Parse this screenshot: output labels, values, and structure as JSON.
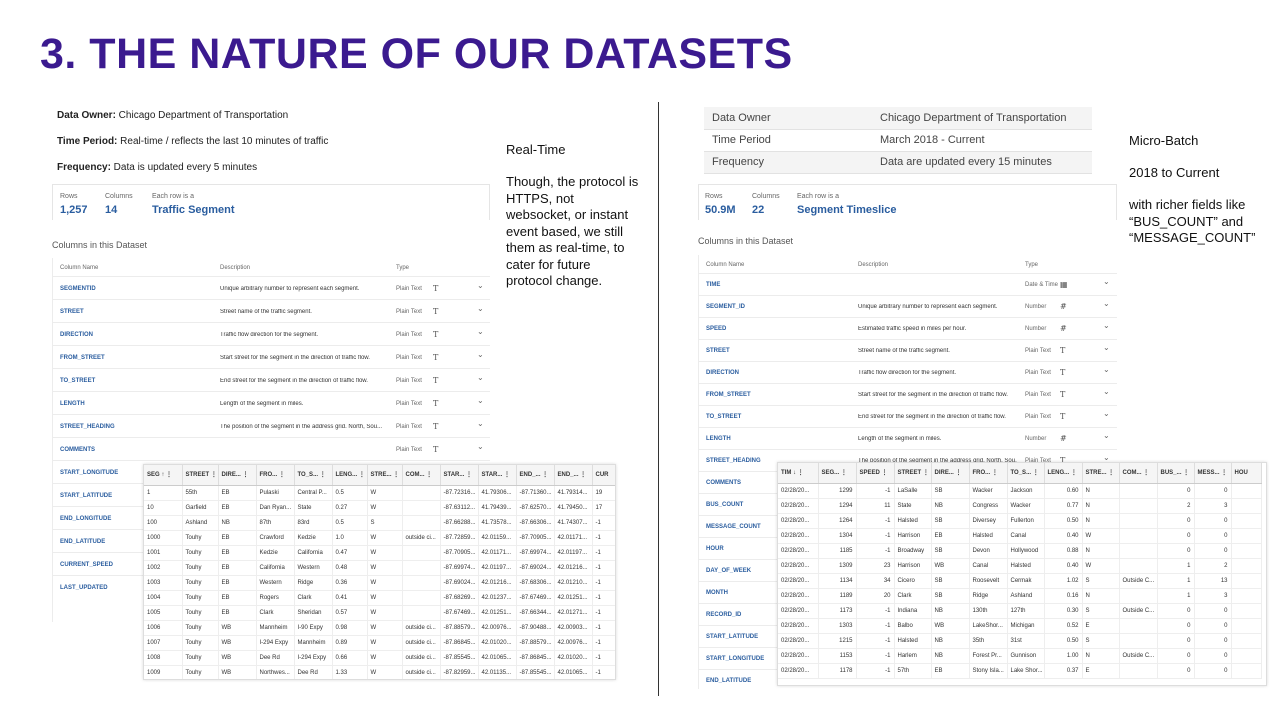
{
  "slide": {
    "title": "3. THE NATURE OF OUR DATASETS"
  },
  "left": {
    "meta": [
      {
        "label": "Data Owner:",
        "value": " Chicago Department of Transportation"
      },
      {
        "label": "Time Period:",
        "value": " Real-time / reflects the last 10 minutes of traffic"
      },
      {
        "label": "Frequency:",
        "value": " Data is updated every 5 minutes"
      }
    ],
    "note": {
      "heading": "Real-Time",
      "lines": [
        "Though, the protocol is",
        "HTTPS, not",
        "websocket, or instant",
        "event based, we still",
        "them as real-time, to",
        "cater for future",
        "protocol change."
      ]
    },
    "summary": {
      "rows_label": "Rows",
      "rows": "1,257",
      "cols_label": "Columns",
      "cols": "14",
      "each_label": "Each row is a",
      "each": "Traffic Segment"
    },
    "columns_title": "Columns in this Dataset",
    "col_header": {
      "name": "Column Name",
      "desc": "Description",
      "type": "Type"
    },
    "columns": [
      {
        "name": "SEGMENTID",
        "desc": "Unique arbitrary number to represent each segment.",
        "type": "Plain Text",
        "icon": "T"
      },
      {
        "name": "STREET",
        "desc": "Street name of the traffic segment.",
        "type": "Plain Text",
        "icon": "T"
      },
      {
        "name": "DIRECTION",
        "desc": "Traffic flow direction for the segment.",
        "type": "Plain Text",
        "icon": "T"
      },
      {
        "name": "FROM_STREET",
        "desc": "Start street for the segment in the direction of traffic flow.",
        "type": "Plain Text",
        "icon": "T"
      },
      {
        "name": "TO_STREET",
        "desc": "End street for the segment in the direction of traffic flow.",
        "type": "Plain Text",
        "icon": "T"
      },
      {
        "name": "LENGTH",
        "desc": "Length of the segment in miles.",
        "type": "Plain Text",
        "icon": "T"
      },
      {
        "name": "STREET_HEADING",
        "desc": "The position of the segment in the address grid. North, Sou...",
        "type": "Plain Text",
        "icon": "T"
      },
      {
        "name": "COMMENTS",
        "desc": "",
        "type": "Plain Text",
        "icon": "T"
      },
      {
        "name": "START_LONGITUDE",
        "desc": "",
        "type": "",
        "icon": ""
      },
      {
        "name": "START_LATITUDE",
        "desc": "",
        "type": "",
        "icon": ""
      },
      {
        "name": "END_LONGITUDE",
        "desc": "",
        "type": "",
        "icon": ""
      },
      {
        "name": "END_LATITUDE",
        "desc": "",
        "type": "",
        "icon": ""
      },
      {
        "name": "CURRENT_SPEED",
        "desc": "",
        "type": "",
        "icon": ""
      },
      {
        "name": "LAST_UPDATED",
        "desc": "",
        "type": "",
        "icon": ""
      }
    ],
    "grid": {
      "headers": [
        "SEG ↑ ⋮",
        "STREET ⋮",
        "DIRE... ⋮",
        "FRO... ⋮",
        "TO_S... ⋮",
        "LENG... ⋮",
        "STRE... ⋮",
        "COM... ⋮",
        "STAR... ⋮",
        "STAR... ⋮",
        "END_... ⋮",
        "END_... ⋮",
        "CUR"
      ],
      "rows": [
        [
          "1",
          "55th",
          "EB",
          "Pulaski",
          "Central P...",
          "0.5",
          "W",
          "",
          "-87.72316...",
          "41.79306...",
          "-87.71360...",
          "41.79314...",
          "19"
        ],
        [
          "10",
          "Garfield",
          "EB",
          "Dan Ryan...",
          "State",
          "0.27",
          "W",
          "",
          "-87.63112...",
          "41.79439...",
          "-87.62570...",
          "41.79450...",
          "17"
        ],
        [
          "100",
          "Ashland",
          "NB",
          "87th",
          "83rd",
          "0.5",
          "S",
          "",
          "-87.66288...",
          "41.73578...",
          "-87.66306...",
          "41.74307...",
          "-1"
        ],
        [
          "1000",
          "Touhy",
          "EB",
          "Crawford",
          "Kedzie",
          "1.0",
          "W",
          "outside ci...",
          "-87.72859...",
          "42.01159...",
          "-87.70905...",
          "42.01171...",
          "-1"
        ],
        [
          "1001",
          "Touhy",
          "EB",
          "Kedzie",
          "California",
          "0.47",
          "W",
          "",
          "-87.70905...",
          "42.01171...",
          "-87.69974...",
          "42.01197...",
          "-1"
        ],
        [
          "1002",
          "Touhy",
          "EB",
          "California",
          "Western",
          "0.48",
          "W",
          "",
          "-87.69974...",
          "42.01197...",
          "-87.69024...",
          "42.01216...",
          "-1"
        ],
        [
          "1003",
          "Touhy",
          "EB",
          "Western",
          "Ridge",
          "0.36",
          "W",
          "",
          "-87.69024...",
          "42.01216...",
          "-87.68306...",
          "42.01210...",
          "-1"
        ],
        [
          "1004",
          "Touhy",
          "EB",
          "Rogers",
          "Clark",
          "0.41",
          "W",
          "",
          "-87.68269...",
          "42.01237...",
          "-87.67469...",
          "42.01251...",
          "-1"
        ],
        [
          "1005",
          "Touhy",
          "EB",
          "Clark",
          "Sheridan",
          "0.57",
          "W",
          "",
          "-87.67469...",
          "42.01251...",
          "-87.66344...",
          "42.01271...",
          "-1"
        ],
        [
          "1006",
          "Touhy",
          "WB",
          "Mannheim",
          "I-90 Expy",
          "0.98",
          "W",
          "outside ci...",
          "-87.88579...",
          "42.00976...",
          "-87.90488...",
          "42.00903...",
          "-1"
        ],
        [
          "1007",
          "Touhy",
          "WB",
          "I-294 Expy",
          "Mannheim",
          "0.89",
          "W",
          "outside ci...",
          "-87.86845...",
          "42.01020...",
          "-87.88579...",
          "42.00976...",
          "-1"
        ],
        [
          "1008",
          "Touhy",
          "WB",
          "Dee Rd",
          "I-294 Expy",
          "0.66",
          "W",
          "outside ci...",
          "-87.85545...",
          "42.01065...",
          "-87.86845...",
          "42.01020...",
          "-1"
        ],
        [
          "1009",
          "Touhy",
          "WB",
          "Northwes...",
          "Dee Rd",
          "1.33",
          "W",
          "outside ci...",
          "-87.82959...",
          "42.01135...",
          "-87.85545...",
          "42.01065...",
          "-1"
        ]
      ]
    }
  },
  "right": {
    "meta": [
      {
        "label": "Data Owner",
        "value": "Chicago Department of Transportation"
      },
      {
        "label": "Time Period",
        "value": "March 2018 - Current"
      },
      {
        "label": "Frequency",
        "value": "Data are updated every 15 minutes"
      }
    ],
    "note": {
      "heading": "Micro-Batch",
      "sub": "2018 to Current",
      "lines": [
        "with richer fields like",
        "“BUS_COUNT”  and",
        "“MESSAGE_COUNT”"
      ]
    },
    "summary": {
      "rows_label": "Rows",
      "rows": "50.9M",
      "cols_label": "Columns",
      "cols": "22",
      "each_label": "Each row is a",
      "each": "Segment Timeslice"
    },
    "columns_title": "Columns in this Dataset",
    "col_header": {
      "name": "Column Name",
      "desc": "Description",
      "type": "Type"
    },
    "columns": [
      {
        "name": "TIME",
        "desc": "",
        "type": "Date & Time",
        "icon": "▦"
      },
      {
        "name": "SEGMENT_ID",
        "desc": "Unique arbitrary number to represent each segment.",
        "type": "Number",
        "icon": "#"
      },
      {
        "name": "SPEED",
        "desc": "Estimated traffic speed in miles per hour.",
        "type": "Number",
        "icon": "#"
      },
      {
        "name": "STREET",
        "desc": "Street name of the traffic segment.",
        "type": "Plain Text",
        "icon": "T"
      },
      {
        "name": "DIRECTION",
        "desc": "Traffic flow direction for the segment.",
        "type": "Plain Text",
        "icon": "T"
      },
      {
        "name": "FROM_STREET",
        "desc": "Start street for the segment in the direction of traffic flow.",
        "type": "Plain Text",
        "icon": "T"
      },
      {
        "name": "TO_STREET",
        "desc": "End street for the segment in the direction of traffic flow.",
        "type": "Plain Text",
        "icon": "T"
      },
      {
        "name": "LENGTH",
        "desc": "Length of the segment in miles.",
        "type": "Number",
        "icon": "#"
      },
      {
        "name": "STREET_HEADING",
        "desc": "The position of the segment in the address grid. North, Sou...",
        "type": "Plain Text",
        "icon": "T"
      },
      {
        "name": "COMMENTS",
        "desc": "",
        "type": "",
        "icon": ""
      },
      {
        "name": "BUS_COUNT",
        "desc": "",
        "type": "",
        "icon": ""
      },
      {
        "name": "MESSAGE_COUNT",
        "desc": "",
        "type": "",
        "icon": ""
      },
      {
        "name": "HOUR",
        "desc": "",
        "type": "",
        "icon": ""
      },
      {
        "name": "DAY_OF_WEEK",
        "desc": "",
        "type": "",
        "icon": ""
      },
      {
        "name": "MONTH",
        "desc": "",
        "type": "",
        "icon": ""
      },
      {
        "name": "RECORD_ID",
        "desc": "",
        "type": "",
        "icon": ""
      },
      {
        "name": "START_LATITUDE",
        "desc": "",
        "type": "",
        "icon": ""
      },
      {
        "name": "START_LONGITUDE",
        "desc": "",
        "type": "",
        "icon": ""
      },
      {
        "name": "END_LATITUDE",
        "desc": "",
        "type": "",
        "icon": ""
      }
    ],
    "grid": {
      "headers": [
        "TIM ↓ ⋮",
        "SEG... ⋮",
        "SPEED ⋮",
        "STREET ⋮",
        "DIRE... ⋮",
        "FRO... ⋮",
        "TO_S... ⋮",
        "LENG... ⋮",
        "STRE... ⋮",
        "COM... ⋮",
        "BUS_... ⋮",
        "MESS... ⋮",
        "HOU"
      ],
      "rows": [
        [
          "02/28/20...",
          "1299",
          "-1",
          "LaSalle",
          "SB",
          "Wacker",
          "Jackson",
          "0.60",
          "N",
          "",
          "0",
          "0",
          ""
        ],
        [
          "02/28/20...",
          "1294",
          "11",
          "State",
          "NB",
          "Congress",
          "Wacker",
          "0.77",
          "N",
          "",
          "2",
          "3",
          ""
        ],
        [
          "02/28/20...",
          "1264",
          "-1",
          "Halsted",
          "SB",
          "Diversey",
          "Fullerton",
          "0.50",
          "N",
          "",
          "0",
          "0",
          ""
        ],
        [
          "02/28/20...",
          "1304",
          "-1",
          "Harrison",
          "EB",
          "Halsted",
          "Canal",
          "0.40",
          "W",
          "",
          "0",
          "0",
          ""
        ],
        [
          "02/28/20...",
          "1185",
          "-1",
          "Broadway",
          "SB",
          "Devon",
          "Hollywood",
          "0.88",
          "N",
          "",
          "0",
          "0",
          ""
        ],
        [
          "02/28/20...",
          "1309",
          "23",
          "Harrison",
          "WB",
          "Canal",
          "Halsted",
          "0.40",
          "W",
          "",
          "1",
          "2",
          ""
        ],
        [
          "02/28/20...",
          "1134",
          "34",
          "Cicero",
          "SB",
          "Roosevelt",
          "Cermak",
          "1.02",
          "S",
          "Outside C...",
          "1",
          "13",
          ""
        ],
        [
          "02/28/20...",
          "1189",
          "20",
          "Clark",
          "SB",
          "Ridge",
          "Ashland",
          "0.16",
          "N",
          "",
          "1",
          "3",
          ""
        ],
        [
          "02/28/20...",
          "1173",
          "-1",
          "Indiana",
          "NB",
          "130th",
          "127th",
          "0.30",
          "S",
          "Outside C...",
          "0",
          "0",
          ""
        ],
        [
          "02/28/20...",
          "1303",
          "-1",
          "Balbo",
          "WB",
          "LakeShor...",
          "Michigan",
          "0.52",
          "E",
          "",
          "0",
          "0",
          ""
        ],
        [
          "02/28/20...",
          "1215",
          "-1",
          "Halsted",
          "NB",
          "35th",
          "31st",
          "0.50",
          "S",
          "",
          "0",
          "0",
          ""
        ],
        [
          "02/28/20...",
          "1153",
          "-1",
          "Harlem",
          "NB",
          "Forest Pr...",
          "Gunnison",
          "1.00",
          "N",
          "Outside C...",
          "0",
          "0",
          ""
        ],
        [
          "02/28/20...",
          "1178",
          "-1",
          "57th",
          "EB",
          "Stony Isla...",
          "Lake Shor...",
          "0.37",
          "E",
          "",
          "0",
          "0",
          ""
        ]
      ]
    }
  }
}
